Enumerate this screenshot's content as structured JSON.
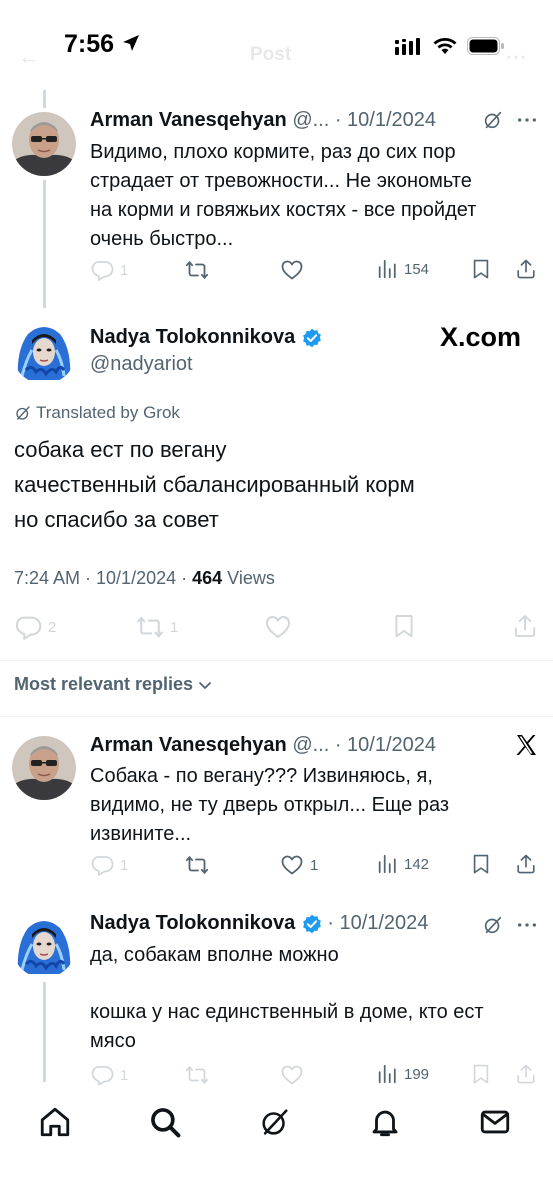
{
  "status_bar": {
    "time": "7:56",
    "faded_title": "Post"
  },
  "reply1": {
    "name": "Arman Vanesqehyan",
    "meta": "@... · 10/1/2024",
    "text_lines": [
      "Видимо, плохо кормите, раз до сих пор",
      "страдает от тревожности... Не экономьте",
      "на корми и говяжьих костях - все пройдет",
      "очень быстро..."
    ],
    "replies": "1",
    "views": "154"
  },
  "main_tweet": {
    "name": "Nadya Tolokonnikova",
    "handle": "@nadyariot",
    "watermark": "X.com",
    "translated_label": "Translated by Grok",
    "text_lines": [
      "собака ест по вегану",
      "качественный сбалансированный корм",
      "но спасибо за совет"
    ],
    "time_date": "7:24 AM · 10/1/2024 · ",
    "views_count": "464",
    "views_label": " Views",
    "replies": "2",
    "reposts": "1"
  },
  "sort_label": "Most relevant replies",
  "reply2": {
    "name": "Arman Vanesqehyan",
    "meta": "@... · 10/1/2024",
    "text_lines": [
      "Собака - по вегану??? Извиняюсь, я,",
      "видимо, не ту дверь открыл... Еще раз",
      "извините..."
    ],
    "replies": "1",
    "likes": "1",
    "views": "142"
  },
  "reply3": {
    "name": "Nadya Tolokonnikova",
    "meta": "· 10/1/2024",
    "text_line1": "да, собакам вполне можно",
    "text_lines2": [
      "кошка у нас единственный в доме, кто ест",
      "мясо"
    ],
    "replies": "1",
    "views": "199"
  },
  "icons": {
    "reply": "reply-icon",
    "repost": "repost-icon",
    "like": "heart-icon",
    "views": "views-icon",
    "bookmark": "bookmark-icon",
    "share": "share-icon",
    "grok": "grok-icon",
    "more": "more-icon"
  },
  "colors": {
    "text": "#0f1419",
    "secondary": "#536471",
    "verified": "#1d9bf0",
    "divider": "#eff3f4"
  }
}
